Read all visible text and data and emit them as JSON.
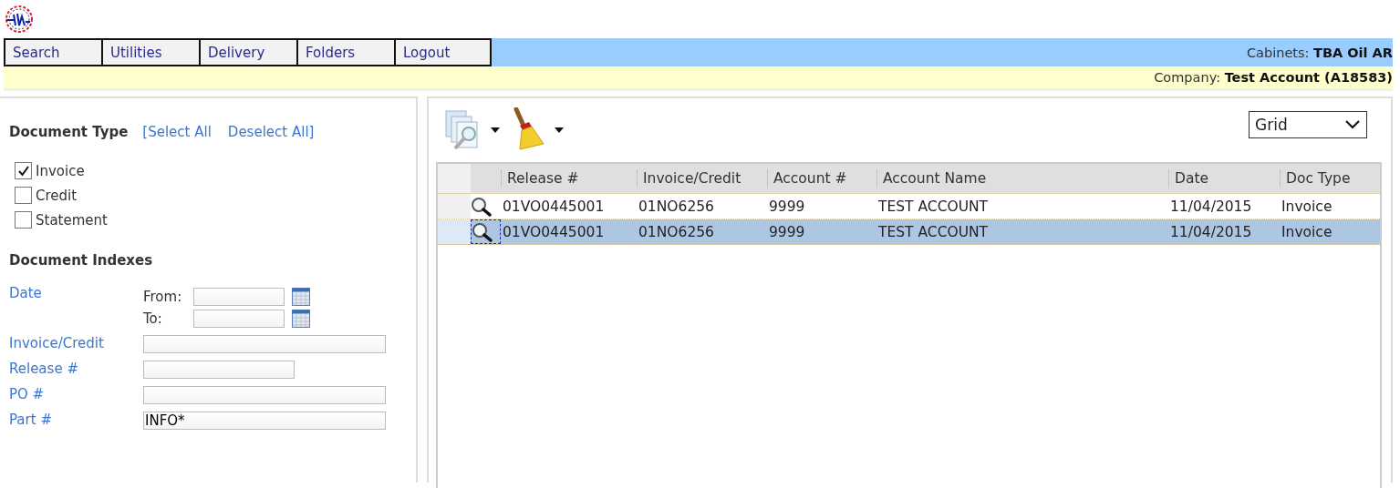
{
  "menu": [
    {
      "label": "Search",
      "selected": false
    },
    {
      "label": "Utilities",
      "selected": false
    },
    {
      "label": "Delivery",
      "selected": false
    },
    {
      "label": "Folders",
      "selected": false
    },
    {
      "label": "Logout",
      "selected": false
    }
  ],
  "cabinets": "Cabinets: **TBA Oil AR**",
  "company": "Company: **Test Account (A18583)**",
  "document_type": {
    "title": "Document Type",
    "open_bracket": "[",
    "select_all": "Select All",
    "deselect_all": "Deselect All",
    "close_bracket": "]",
    "options": [
      {
        "label": "Invoice",
        "checked": true
      },
      {
        "label": "Credit",
        "checked": false
      },
      {
        "label": "Statement",
        "checked": false
      }
    ]
  },
  "document_indexes": {
    "title": "Document Indexes",
    "fields": [
      {
        "kind": "date_range",
        "label": "Date",
        "from_label": "From:",
        "to_label": "To:"
      },
      {
        "kind": "text",
        "label": "Invoice/Credit"
      },
      {
        "kind": "text",
        "label": "Release #"
      },
      {
        "kind": "text",
        "label": "PO #"
      },
      {
        "kind": "text",
        "label": "Part #",
        "value": "INFO*"
      }
    ]
  },
  "view_select": {
    "value": "Grid"
  },
  "table": {
    "columns": [
      "Release #",
      "Invoice/Credit",
      "Account #",
      "Account Name",
      "Date",
      "Doc Type"
    ],
    "rows": [
      {
        "selected": false,
        "cells": [
          "01VO0445001",
          "01NO6256",
          "9999",
          "TEST ACCOUNT",
          "11/04/2015",
          "Invoice"
        ]
      },
      {
        "selected": true,
        "cells": [
          "01VO0445001",
          "01NO6256",
          "9999",
          "TEST ACCOUNT",
          "11/04/2015",
          "Invoice"
        ]
      }
    ]
  }
}
